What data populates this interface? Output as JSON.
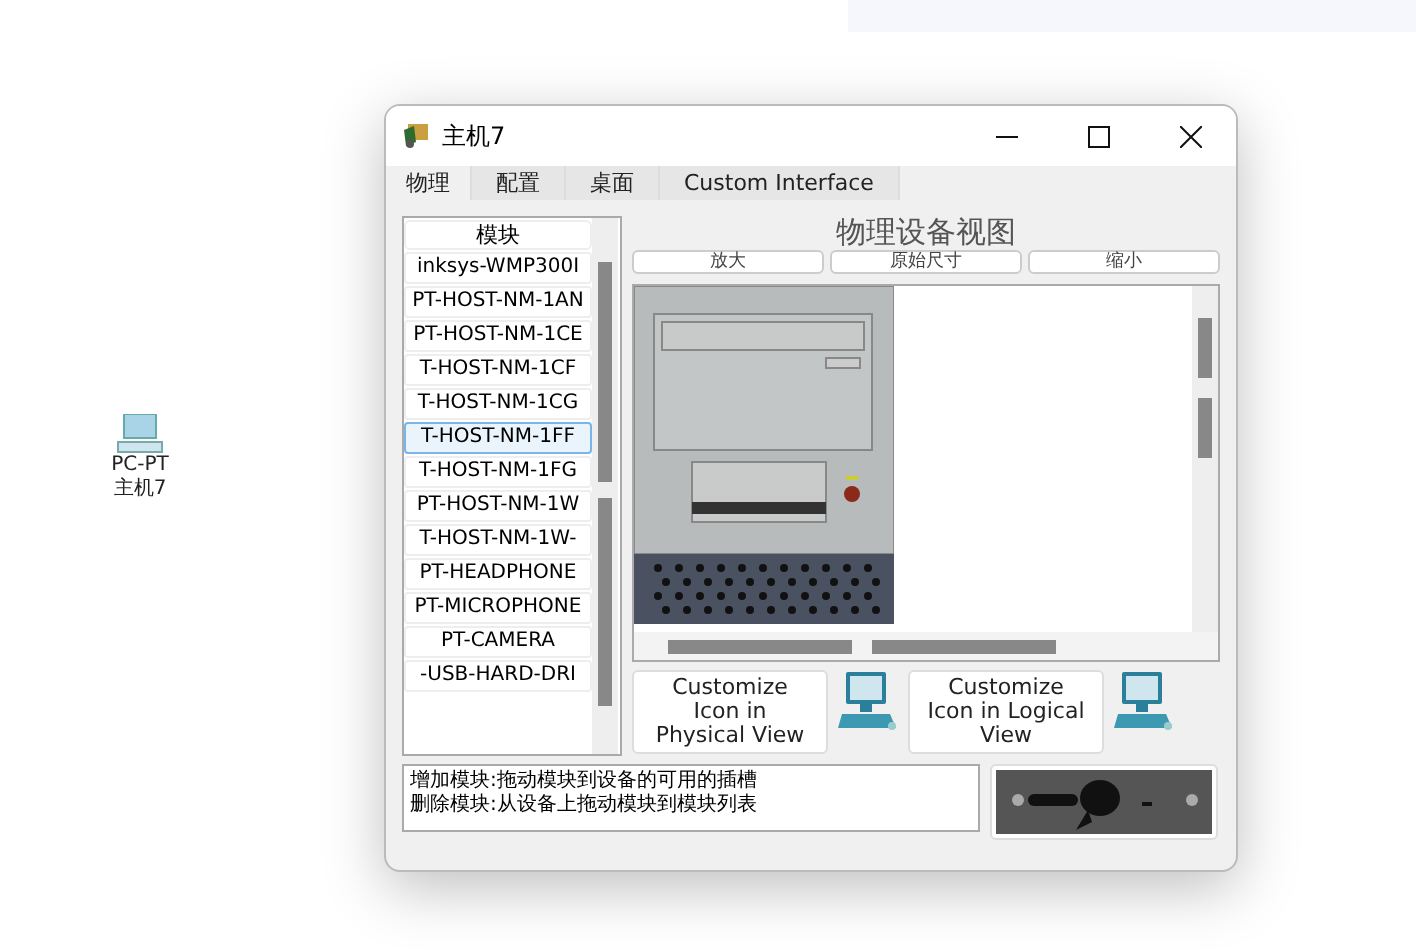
{
  "desktop_icon": {
    "type": "PC-PT",
    "name": "主机7"
  },
  "window": {
    "title": "主机7"
  },
  "tabs": [
    {
      "label": "物理",
      "selected": true
    },
    {
      "label": "配置",
      "selected": false
    },
    {
      "label": "桌面",
      "selected": false
    },
    {
      "label": "Custom Interface",
      "selected": false
    }
  ],
  "modules": {
    "header": "模块",
    "items": [
      {
        "label": "inksys-WMP300I",
        "selected": false
      },
      {
        "label": "PT-HOST-NM-1AN",
        "selected": false
      },
      {
        "label": "PT-HOST-NM-1CE",
        "selected": false
      },
      {
        "label": "T-HOST-NM-1CF",
        "selected": false
      },
      {
        "label": "T-HOST-NM-1CG",
        "selected": false
      },
      {
        "label": "T-HOST-NM-1FF",
        "selected": true
      },
      {
        "label": "T-HOST-NM-1FG",
        "selected": false
      },
      {
        "label": "PT-HOST-NM-1W",
        "selected": false
      },
      {
        "label": "T-HOST-NM-1W-",
        "selected": false
      },
      {
        "label": "PT-HEADPHONE",
        "selected": false
      },
      {
        "label": "PT-MICROPHONE",
        "selected": false
      },
      {
        "label": "PT-CAMERA",
        "selected": false
      },
      {
        "label": "-USB-HARD-DRI",
        "selected": false
      }
    ]
  },
  "view": {
    "title": "物理设备视图",
    "zoom_buttons": [
      "放大",
      "原始尺寸",
      "缩小"
    ]
  },
  "customize_buttons": [
    {
      "label": "Customize Icon in Physical View"
    },
    {
      "label": "Customize Icon in Logical View"
    }
  ],
  "help_text": [
    "增加模块:拖动模块到设备的可用的插槽",
    "删除模块:从设备上拖动模块到模块列表"
  ]
}
